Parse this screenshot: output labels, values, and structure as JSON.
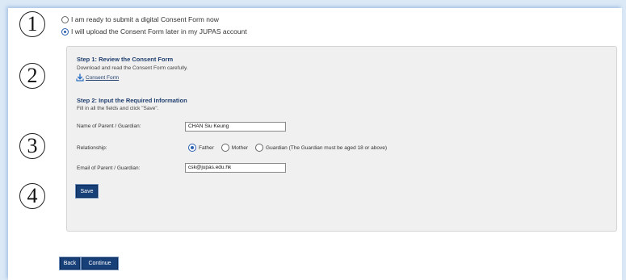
{
  "callouts": [
    "1",
    "2",
    "3",
    "4"
  ],
  "submission_options": [
    {
      "label": "I am ready to submit a digital Consent Form now",
      "checked": false
    },
    {
      "label": "I will upload the Consent Form later in my JUPAS account",
      "checked": true
    }
  ],
  "step1": {
    "title": "Step 1: Review the Consent Form",
    "description": "Download and read the Consent Form carefully.",
    "link_label": "Consent Form",
    "link_icon": "download-icon"
  },
  "step2": {
    "title": "Step 2: Input the Required Information",
    "description": "Fill in all the fields and click \"Save\"."
  },
  "form": {
    "name_label": "Name of Parent / Guardian:",
    "name_value": "CHAN Siu Keung",
    "relationship_label": "Relationship:",
    "relationship_options": [
      {
        "label": "Father",
        "checked": true
      },
      {
        "label": "Mother",
        "checked": false
      },
      {
        "label": "Guardian (The Guardian must be aged 18 or above)",
        "checked": false
      }
    ],
    "email_label": "Email of Parent / Guardian:",
    "email_value": "csk@jupas.edu.hk",
    "save_label": "Save"
  },
  "footer": {
    "back_label": "Back",
    "continue_label": "Continue"
  },
  "colors": {
    "accent": "#173f78",
    "heading": "#1f3e6e",
    "radio_selected": "#2b5fb0",
    "box_background": "#f0f0f0"
  }
}
